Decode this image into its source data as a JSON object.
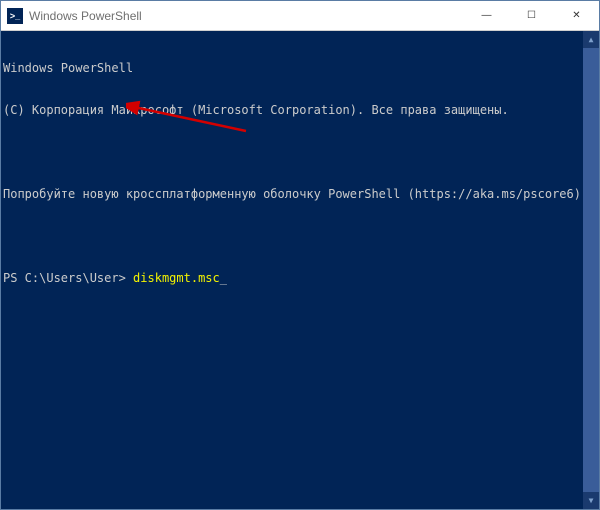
{
  "window": {
    "title": "Windows PowerShell",
    "icon_label": "powershell-icon",
    "icon_glyph": ">_"
  },
  "controls": {
    "minimize": "—",
    "maximize": "☐",
    "close": "✕"
  },
  "terminal": {
    "header_line1": "Windows PowerShell",
    "header_line2": "(С) Корпорация Майкрософт (Microsoft Corporation). Все права защищены.",
    "tip_line": "Попробуйте новую кроссплатформенную оболочку PowerShell (https://aka.ms/pscore6)",
    "prompt": "PS C:\\Users\\User> ",
    "command": "diskmgmt.msc",
    "cursor": "_"
  },
  "scrollbar": {
    "up": "▲",
    "down": "▼"
  },
  "annotation": {
    "type": "arrow",
    "color": "#d30000"
  }
}
